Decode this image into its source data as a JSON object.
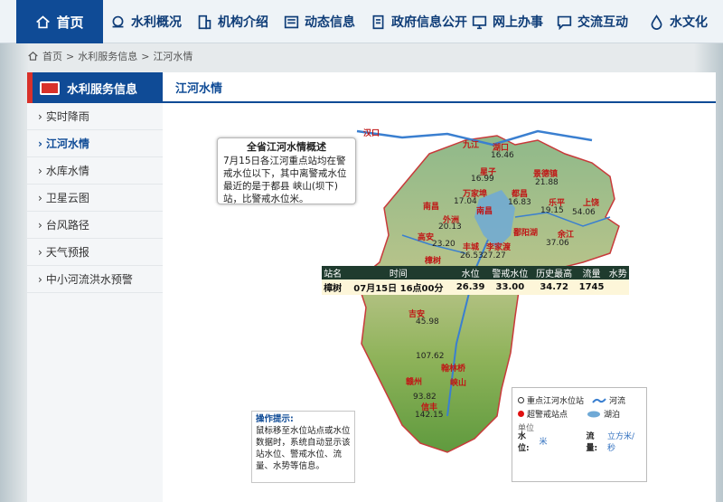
{
  "nav": {
    "home": "首页",
    "items": [
      "水利概况",
      "机构介绍",
      "动态信息",
      "政府信息公开",
      "网上办事",
      "交流互动",
      "水文化"
    ]
  },
  "breadcrumb": [
    "首页",
    "水利服务信息",
    "江河水情"
  ],
  "sidebar": {
    "title": "水利服务信息",
    "items": [
      "实时降雨",
      "江河水情",
      "水库水情",
      "卫星云图",
      "台风路径",
      "天气预报",
      "中小河流洪水预警"
    ],
    "active_index": 1
  },
  "content": {
    "tab_title": "江河水情",
    "summary": {
      "title": "全省江河水情概述",
      "text": "7月15日各江河重点站均在警戒水位以下，其中离警戒水位最近的是于都县 峡山(坝下)站，比警戒水位米。"
    },
    "table": {
      "headers": [
        "站名",
        "时间",
        "水位",
        "警戒水位",
        "历史最高",
        "流量",
        "水势"
      ],
      "row": [
        "樟树",
        "07月15日 16点00分",
        "26.39",
        "33.00",
        "34.72",
        "1745",
        ""
      ]
    },
    "tips": {
      "title": "操作提示:",
      "text": "鼠标移至水位站点或水位数据时，系统自动显示该站水位、警戒水位、流量、水势等信息。"
    },
    "legend": {
      "items": [
        "重点江河水位站",
        "河流",
        "超警戒站点",
        "湖泊"
      ],
      "unit_title": "单位",
      "level_label": "水位:",
      "level_unit": "米",
      "flow_label": "流量:",
      "flow_unit": "立方米/秒"
    },
    "map_labels": {
      "hankou": "汉口",
      "jiujiang": "九江",
      "hukou": "湖口",
      "v1646": "16.46",
      "xingzi": "星子",
      "v1699": "16.99",
      "jingdezhen": "景德镇",
      "v2188": "21.88",
      "wannian": "万家埠",
      "v1704": "17.04",
      "nanchang": "南昌",
      "duchang": "都昌",
      "v1683": "16.83",
      "leping": "乐平",
      "v1915": "19.15",
      "waizhou": "外洲",
      "poyanghu": "鄱阳湖",
      "v2013": "20.13",
      "gaoan": "高安",
      "v2320": "23.20",
      "fengcheng": "丰城",
      "v2653": "26.53",
      "lixi": "李家渡",
      "v2727": "27.27",
      "yujiang": "余江",
      "v3706": "37.06",
      "shangrao": "上饶",
      "v5406": "54.06",
      "zhangshu": "樟树",
      "v2639": "26.39",
      "jian": "吉安",
      "v4598": "45.98",
      "v10762": "107.62",
      "tuokeqiao": "翰林桥",
      "ganzhou": "赣州",
      "xiashan": "峡山",
      "v9382": "93.82",
      "yudu": "信丰",
      "v14215": "142.15"
    }
  }
}
